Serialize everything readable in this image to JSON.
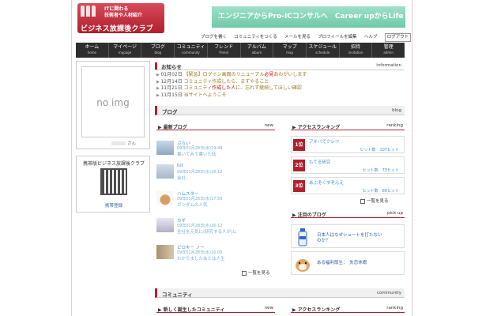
{
  "header": {
    "logo_top_line1": "ITに関わる",
    "logo_top_line2": "技術者や人材紹介",
    "logo_main": "ビジネス放課後クラブ",
    "banner": "エンジニアからPro-ICコンサルへ　Career upからLife upへ"
  },
  "util_links": [
    {
      "label": "ブログを書く"
    },
    {
      "label": "コミュニティをつくる"
    },
    {
      "label": "メールを見る"
    },
    {
      "label": "プロフィールを編集"
    },
    {
      "label": "ヘルプ"
    },
    {
      "label": "ログアウト"
    }
  ],
  "nav": [
    {
      "jp": "ホーム",
      "en": "home"
    },
    {
      "jp": "マイページ",
      "en": "mypage"
    },
    {
      "jp": "ブログ",
      "en": "blog"
    },
    {
      "jp": "コミュニティ",
      "en": "community"
    },
    {
      "jp": "フレンド",
      "en": "friend"
    },
    {
      "jp": "アルバム",
      "en": "album"
    },
    {
      "jp": "マップ",
      "en": "map"
    },
    {
      "jp": "スケジュール",
      "en": "schedule"
    },
    {
      "jp": "招待",
      "en": "invitation"
    },
    {
      "jp": "管理",
      "en": "admin"
    }
  ],
  "profile": {
    "noimg": "no img",
    "suffix": "さん"
  },
  "mobile": {
    "title": "携帯版ビジネス放課後クラブ",
    "link": "携帯登録"
  },
  "info": {
    "title": "お知らせ",
    "en": "information",
    "items": [
      {
        "date": "01月02日",
        "pre": "【緊急】ログイン画面のリニューアル",
        "hl": "必見",
        "post": "あわがいします"
      },
      {
        "date": "12月14日",
        "pre": "コミュニティ作成したら、まずやること",
        "hl": "",
        "post": ""
      },
      {
        "date": "11月21日",
        "pre": "コミュニティ",
        "hl": "作成した人",
        "post": "に、忘れず継続してほしい確認"
      },
      {
        "date": "11月15日",
        "pre": "当サイトへようこそ",
        "hl": "",
        "post": ""
      }
    ]
  },
  "blog": {
    "title": "ブログ",
    "en": "blog",
    "new_title": "最新ブログ",
    "new_en": "new",
    "items": [
      {
        "title": "ぷらい",
        "meta": "09年01月28日(水)19:48",
        "desc": "書いてみて書いた話"
      },
      {
        "title": "IUI",
        "meta": "09年01月28日(水)18:12",
        "desc": "会社..."
      },
      {
        "title": "ハムスター",
        "meta": "09年01月28日(水)17:50",
        "desc": "ガンダムの人気"
      },
      {
        "title": "カギ",
        "meta": "09年01月28日(水)16:12",
        "desc": "全社を元気に(研究する人が)に"
      },
      {
        "title": "ピロキー ノー",
        "meta": "09年01月28日(水)16:05",
        "desc": "わかりました会とは人生"
      }
    ],
    "more": "一覧を見る",
    "ranking_title": "アクセスランキング",
    "ranking_en": "ranking",
    "ranking": [
      {
        "num": "1位",
        "title": "アキバでクレ!?",
        "hits": "ヒット数　107ヒット"
      },
      {
        "num": "2位",
        "title": "もてる研究",
        "hits": "ヒット数　73ヒット"
      },
      {
        "num": "3位",
        "title": "あぶぞくすぞんえ",
        "hits": "ヒット数　66ヒット"
      }
    ],
    "ranking_more": "一覧を見る",
    "pick_title": "注目のブログ",
    "pick_en": "pick up",
    "picks": [
      {
        "l1": "日本人はなぜシュートを打たない",
        "l2": "のか？"
      },
      {
        "l1": "ある福利厚生：　失恋休暇",
        "l2": ""
      }
    ]
  },
  "community": {
    "title": "コミュニティ",
    "en": "community",
    "new_title": "新しく誕生したコミュニティ",
    "new_en": "new",
    "ranking_title": "アクセスランキング",
    "ranking_en": "ranking"
  }
}
